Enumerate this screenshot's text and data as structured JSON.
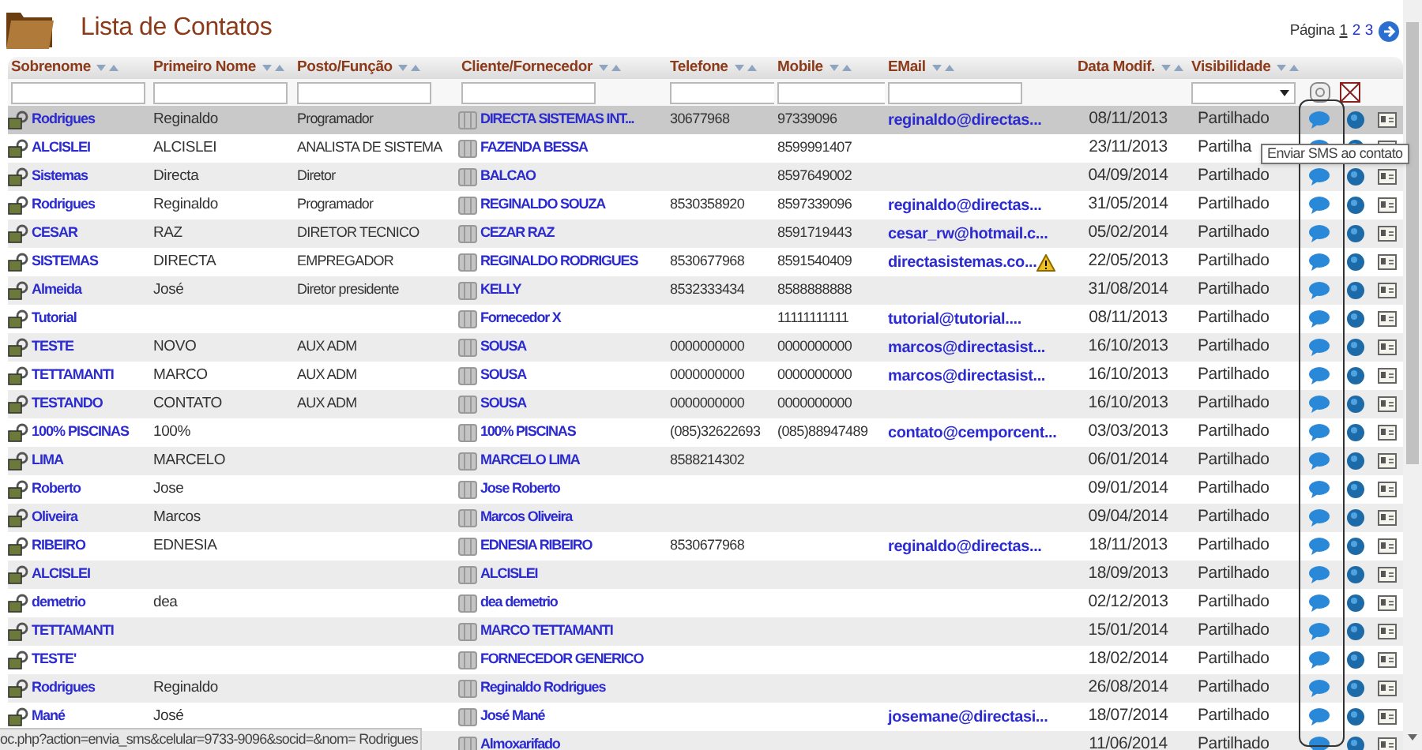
{
  "title": "Lista de Contatos",
  "pagination": {
    "label": "Página",
    "pages": [
      {
        "label": "1",
        "selected": true
      },
      {
        "label": "2",
        "selected": false
      },
      {
        "label": "3",
        "selected": false
      }
    ]
  },
  "columns": [
    {
      "label": "Sobrenome",
      "kind": "text"
    },
    {
      "label": "Primeiro Nome",
      "kind": "text"
    },
    {
      "label": "Posto/Função",
      "kind": "text"
    },
    {
      "label": "Cliente/Fornecedor",
      "kind": "text"
    },
    {
      "label": "Telefone",
      "kind": "text"
    },
    {
      "label": "Mobile",
      "kind": "text"
    },
    {
      "label": "EMail",
      "kind": "text"
    },
    {
      "label": "Data Modif.",
      "kind": "date"
    },
    {
      "label": "Visibilidade",
      "kind": "select"
    }
  ],
  "rows": [
    {
      "surname": "Rodrigues",
      "first_name": "Reginaldo",
      "position": "Programador",
      "client": "DIRECTA SISTEMAS INT...",
      "phone": "30677968",
      "mobile": "97339096",
      "email": "reginaldo@directas...",
      "warning": false,
      "modified": "08/11/2013",
      "visibility": "Partilhado",
      "selected": true
    },
    {
      "surname": "ALCISLEI",
      "first_name": "ALCISLEI",
      "position": "ANALISTA DE SISTEMA",
      "client": "FAZENDA BESSA",
      "mobile": "8599991407",
      "warning": false,
      "modified": "23/11/2013",
      "visibility": "Partilha",
      "selected": false
    },
    {
      "surname": "Sistemas",
      "first_name": "Directa",
      "position": "Diretor",
      "client": "BALCAO",
      "mobile": "8597649002",
      "warning": false,
      "modified": "04/09/2014",
      "visibility": "Partilhado",
      "selected": false
    },
    {
      "surname": "Rodrigues",
      "first_name": "Reginaldo",
      "position": "Programador",
      "client": "REGINALDO SOUZA",
      "phone": "8530358920",
      "mobile": "8597339096",
      "email": "reginaldo@directas...",
      "warning": false,
      "modified": "31/05/2014",
      "visibility": "Partilhado",
      "selected": false
    },
    {
      "surname": "CESAR",
      "first_name": "RAZ",
      "position": "DIRETOR TECNICO",
      "client": "CEZAR RAZ",
      "mobile": "8591719443",
      "email": "cesar_rw@hotmail.c...",
      "warning": false,
      "modified": "05/02/2014",
      "visibility": "Partilhado",
      "selected": false
    },
    {
      "surname": "SISTEMAS",
      "first_name": "DIRECTA",
      "position": "EMPREGADOR",
      "client": "REGINALDO RODRIGUES",
      "phone": "8530677968",
      "mobile": "8591540409",
      "email": "directasistemas.co...",
      "warning": true,
      "modified": "22/05/2013",
      "visibility": "Partilhado",
      "selected": false
    },
    {
      "surname": "Almeida",
      "first_name": "José",
      "position": "Diretor presidente",
      "client": "KELLY",
      "phone": "8532333434",
      "mobile": "8588888888",
      "warning": false,
      "modified": "31/08/2014",
      "visibility": "Partilhado",
      "selected": false
    },
    {
      "surname": "Tutorial",
      "client": "Fornecedor X",
      "mobile": "11111111111",
      "email": "tutorial@tutorial....",
      "warning": false,
      "modified": "08/11/2013",
      "visibility": "Partilhado",
      "selected": false
    },
    {
      "surname": "TESTE",
      "first_name": "NOVO",
      "position": "AUX ADM",
      "client": "SOUSA",
      "phone": "0000000000",
      "mobile": "0000000000",
      "email": "marcos@directasist...",
      "warning": false,
      "modified": "16/10/2013",
      "visibility": "Partilhado",
      "selected": false
    },
    {
      "surname": "TETTAMANTI",
      "first_name": "MARCO",
      "position": "AUX ADM",
      "client": "SOUSA",
      "phone": "0000000000",
      "mobile": "0000000000",
      "email": "marcos@directasist...",
      "warning": false,
      "modified": "16/10/2013",
      "visibility": "Partilhado",
      "selected": false
    },
    {
      "surname": "TESTANDO",
      "first_name": "CONTATO",
      "position": "AUX ADM",
      "client": "SOUSA",
      "phone": "0000000000",
      "mobile": "0000000000",
      "warning": false,
      "modified": "16/10/2013",
      "visibility": "Partilhado",
      "selected": false
    },
    {
      "surname": "100% PISCINAS",
      "first_name": "100%",
      "client": "100% PISCINAS",
      "phone": "(085)32622693",
      "mobile": "(085)88947489",
      "email": "contato@cemporcent...",
      "warning": false,
      "modified": "03/03/2013",
      "visibility": "Partilhado",
      "selected": false
    },
    {
      "surname": "LIMA",
      "first_name": "MARCELO",
      "client": "MARCELO LIMA",
      "phone": "8588214302",
      "warning": false,
      "modified": "06/01/2014",
      "visibility": "Partilhado",
      "selected": false
    },
    {
      "surname": "Roberto",
      "first_name": "Jose",
      "client": "Jose Roberto",
      "warning": false,
      "modified": "09/01/2014",
      "visibility": "Partilhado",
      "selected": false
    },
    {
      "surname": "Oliveira",
      "first_name": "Marcos",
      "client": "Marcos Oliveira",
      "warning": false,
      "modified": "09/04/2014",
      "visibility": "Partilhado",
      "selected": false
    },
    {
      "surname": "RIBEIRO",
      "first_name": "EDNESIA",
      "client": "EDNESIA RIBEIRO",
      "phone": "8530677968",
      "email": "reginaldo@directas...",
      "warning": false,
      "modified": "18/11/2013",
      "visibility": "Partilhado",
      "selected": false
    },
    {
      "surname": "ALCISLEI",
      "client": "ALCISLEI",
      "warning": false,
      "modified": "18/09/2013",
      "visibility": "Partilhado",
      "selected": false
    },
    {
      "surname": "demetrio",
      "first_name": "dea",
      "client": "dea demetrio",
      "warning": false,
      "modified": "02/12/2013",
      "visibility": "Partilhado",
      "selected": false
    },
    {
      "surname": "TETTAMANTI",
      "client": "MARCO TETTAMANTI",
      "warning": false,
      "modified": "15/01/2014",
      "visibility": "Partilhado",
      "selected": false
    },
    {
      "surname": "TESTE'",
      "client": "FORNECEDOR GENERICO",
      "warning": false,
      "modified": "18/02/2014",
      "visibility": "Partilhado",
      "selected": false
    },
    {
      "surname": "Rodrigues",
      "first_name": "Reginaldo",
      "client": "Reginaldo Rodrigues",
      "warning": false,
      "modified": "26/08/2014",
      "visibility": "Partilhado",
      "selected": false
    },
    {
      "surname": "Mané",
      "first_name": "José",
      "client": "José Mané",
      "email": "josemane@directasi...",
      "warning": false,
      "modified": "18/07/2014",
      "visibility": "Partilhado",
      "selected": false
    },
    {
      "client": "Almoxarifado",
      "warning": false,
      "modified": "11/06/2014",
      "visibility": "Partilhado",
      "selected": false
    }
  ],
  "tooltip": "Enviar SMS ao contato",
  "status_bar": "oc.php?action=envia_sms&celular=9733-9096&socid=&nom= Rodrigues"
}
